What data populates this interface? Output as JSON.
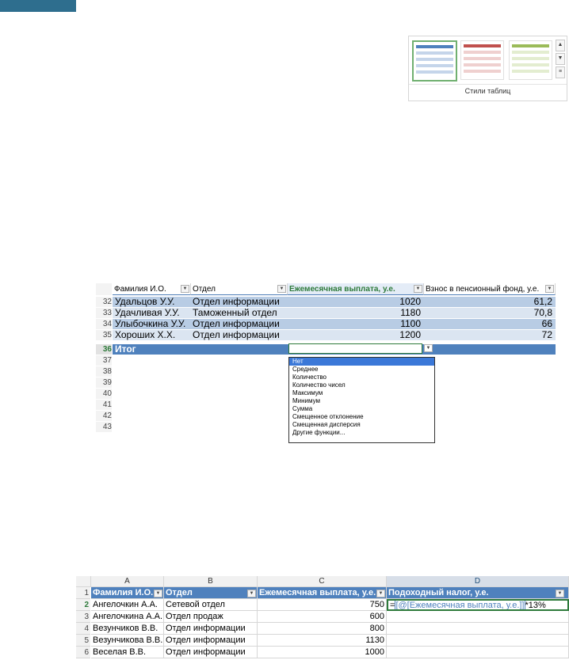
{
  "ribbon": {
    "gallery_caption": "Стили таблиц"
  },
  "table1": {
    "headers": [
      "Фамилия И.О.",
      "Отдел",
      "Ежемесячная выплата, у.е.",
      "Взнос в пенсионный фонд, у.е."
    ],
    "rows": [
      {
        "num": "32",
        "name": "Удальцов У.У.",
        "dept": "Отдел информации",
        "pay": "1020",
        "fund": "61,2"
      },
      {
        "num": "33",
        "name": "Удачливая У.У.",
        "dept": "Таможенный отдел",
        "pay": "1180",
        "fund": "70,8"
      },
      {
        "num": "34",
        "name": "Улыбочкина У.У.",
        "dept": "Отдел информации",
        "pay": "1100",
        "fund": "66"
      },
      {
        "num": "35",
        "name": "Хороших Х.Х.",
        "dept": "Отдел информации",
        "pay": "1200",
        "fund": "72"
      }
    ],
    "total_num": "36",
    "total_label": "Итог",
    "empty_rows": [
      "37",
      "38",
      "39",
      "40",
      "41",
      "42",
      "43"
    ],
    "dropdown_options": [
      "Нет",
      "Среднее",
      "Количество",
      "Количество чисел",
      "Максимум",
      "Минимум",
      "Сумма",
      "Смещенное отклонение",
      "Смещенная дисперсия",
      "Другие функции..."
    ]
  },
  "table2": {
    "columns": [
      "A",
      "B",
      "C",
      "D"
    ],
    "headers": [
      "Фамилия И.О.",
      "Отдел",
      "Ежемесячная выплата, у.е.",
      "Подоходный налог, у.е."
    ],
    "formula_prefix": "=",
    "formula_ref": "[@[Ежемесячная выплата, у.е.]]",
    "formula_suffix": "*13%",
    "rows": [
      {
        "num": "2",
        "name": "Ангелочкин А.А.",
        "dept": "Сетевой отдел",
        "pay": "750"
      },
      {
        "num": "3",
        "name": "Ангелочкина А.А.",
        "dept": "Отдел продаж",
        "pay": "600"
      },
      {
        "num": "4",
        "name": "Везунчиков В.В.",
        "dept": "Отдел информации",
        "pay": "800"
      },
      {
        "num": "5",
        "name": "Везунчикова В.В.",
        "dept": "Отдел информации",
        "pay": "1130"
      },
      {
        "num": "6",
        "name": "Веселая В.В.",
        "dept": "Отдел информации",
        "pay": "1000"
      }
    ],
    "header_row_num": "1"
  },
  "colors": {
    "accent": "#4f81bd",
    "band_light": "#dbe5f1",
    "band_dark": "#b8cce4",
    "selection": "#3b78d8"
  }
}
